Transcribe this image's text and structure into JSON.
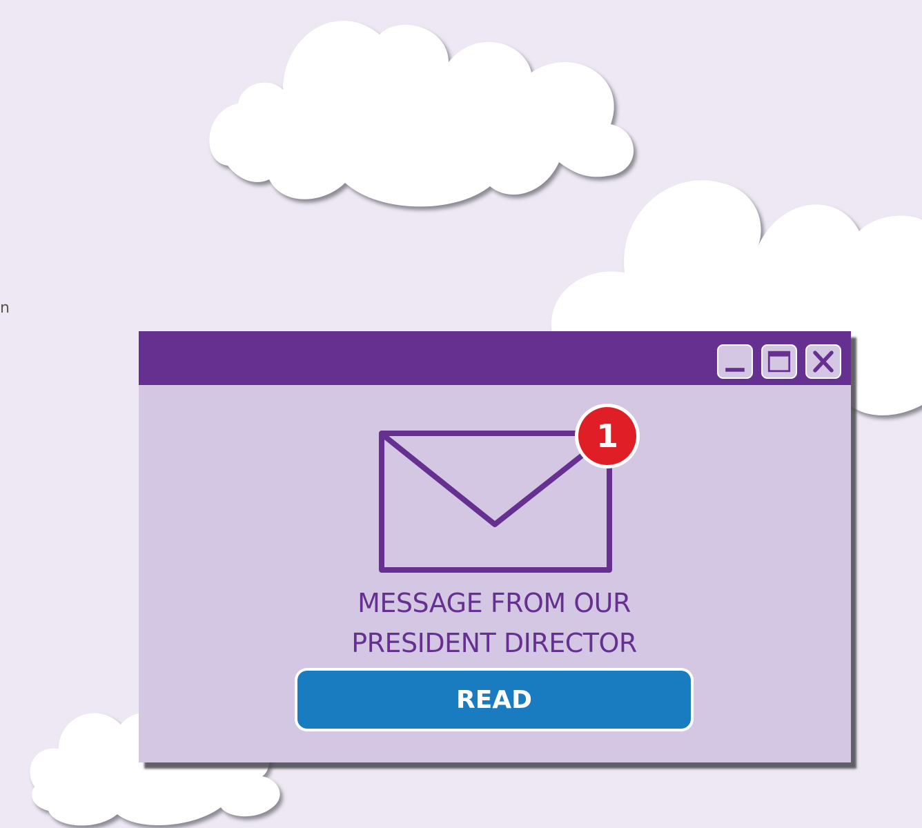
{
  "colors": {
    "background": "#ede8f3",
    "window_body": "#d3c7e3",
    "titlebar": "#663090",
    "envelope_stroke": "#663090",
    "badge": "#e01e25",
    "button": "#1a7cc0",
    "cloud": "#ffffff"
  },
  "edge_text": "n",
  "window": {
    "controls": [
      {
        "name": "minimize",
        "icon": "minimize-icon"
      },
      {
        "name": "maximize",
        "icon": "maximize-icon"
      },
      {
        "name": "close",
        "icon": "close-icon"
      }
    ],
    "envelope_icon": "envelope-icon",
    "badge_count": "1",
    "message": {
      "line1": "MESSAGE FROM OUR",
      "line2": "PRESIDENT DIRECTOR"
    },
    "read_label": "READ"
  }
}
